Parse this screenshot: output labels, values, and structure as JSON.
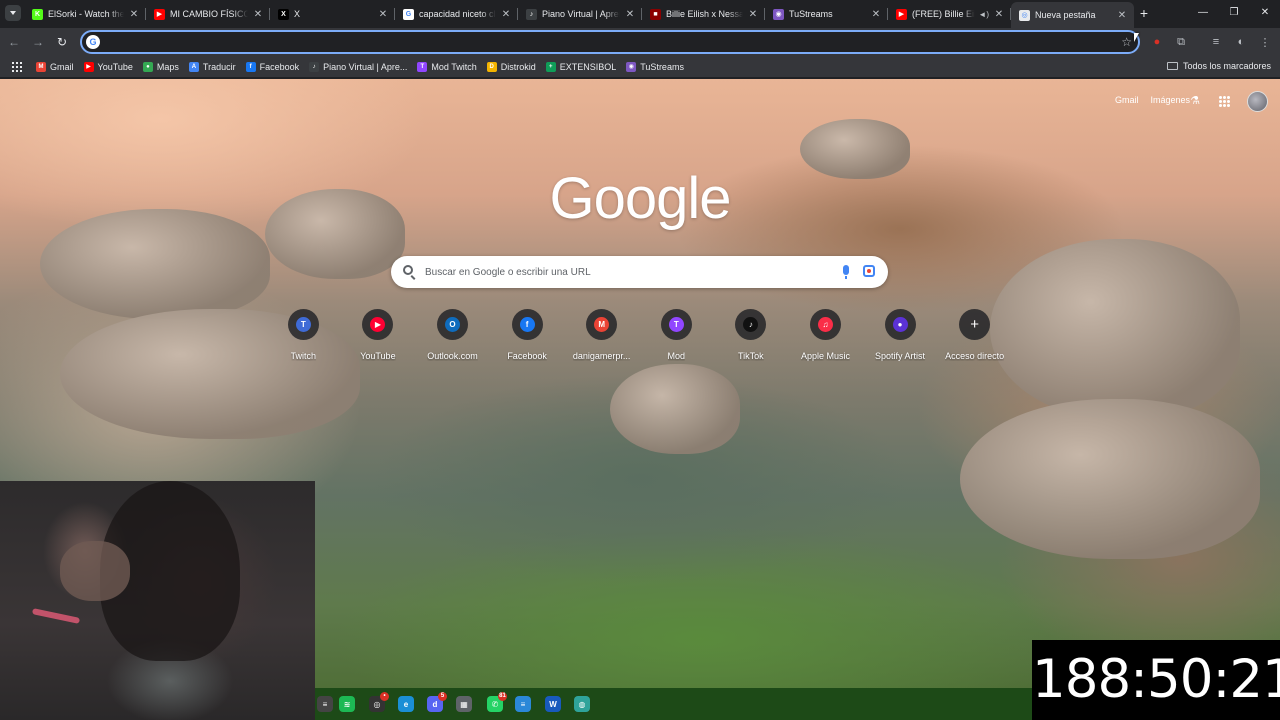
{
  "tabs": [
    {
      "title": "ElSorki - Watch the V",
      "favicon": "kick-icon",
      "color": "#53fc18",
      "glyph": "K",
      "width": 122,
      "active": false
    },
    {
      "title": "MI CAMBIO FÍSICO P",
      "favicon": "youtube-icon",
      "color": "#ff0000",
      "glyph": "▶",
      "width": 124,
      "active": false
    },
    {
      "title": "X",
      "favicon": "x-icon",
      "color": "#000000",
      "glyph": "X",
      "width": 125,
      "active": false
    },
    {
      "title": "capacidad niceto club",
      "favicon": "google-icon",
      "color": "#ffffff",
      "glyph": "G",
      "width": 123,
      "active": false
    },
    {
      "title": "Piano Virtual | Apren",
      "favicon": "piano-icon",
      "color": "#3c4043",
      "glyph": "♪",
      "width": 124,
      "active": false
    },
    {
      "title": "Billie Eilish x Nessa B",
      "favicon": "film-icon",
      "color": "#8b0000",
      "glyph": "■",
      "width": 123,
      "active": false
    },
    {
      "title": "TuStreams",
      "favicon": "tustreams-icon",
      "color": "#7e57c2",
      "glyph": "◉",
      "width": 123,
      "active": false
    },
    {
      "title": "(FREE) Billie Eilish",
      "favicon": "youtube-icon",
      "color": "#ff0000",
      "glyph": "▶",
      "width": 123,
      "active": false,
      "audio": true
    },
    {
      "title": "Nueva pestaña",
      "favicon": "chrome-icon",
      "color": "#e8eaed",
      "glyph": "◎",
      "width": 123,
      "active": true
    }
  ],
  "omnibox": {
    "value": "",
    "placeholder": ""
  },
  "bookmarks": [
    {
      "label": "Gmail",
      "icon": "gmail-icon",
      "color": "#ea4335",
      "glyph": "M"
    },
    {
      "label": "YouTube",
      "icon": "youtube-icon",
      "color": "#ff0000",
      "glyph": "▶"
    },
    {
      "label": "Maps",
      "icon": "maps-icon",
      "color": "#34a853",
      "glyph": "●"
    },
    {
      "label": "Traducir",
      "icon": "translate-icon",
      "color": "#4285f4",
      "glyph": "A"
    },
    {
      "label": "Facebook",
      "icon": "facebook-icon",
      "color": "#1877f2",
      "glyph": "f"
    },
    {
      "label": "Piano Virtual | Apre...",
      "icon": "piano-icon",
      "color": "#3c4043",
      "glyph": "♪"
    },
    {
      "label": "Mod Twitch",
      "icon": "twitch-icon",
      "color": "#9146ff",
      "glyph": "T"
    },
    {
      "label": "Distrokid",
      "icon": "distrokid-icon",
      "color": "#f4b400",
      "glyph": "D"
    },
    {
      "label": "EXTENSIBOL",
      "icon": "sheets-icon",
      "color": "#0f9d58",
      "glyph": "+"
    },
    {
      "label": "TuStreams",
      "icon": "tustreams-icon",
      "color": "#7e57c2",
      "glyph": "◉"
    }
  ],
  "all_bookmarks_label": "Todos los marcadores",
  "ntp": {
    "links": [
      "Gmail",
      "Imágenes"
    ],
    "logo": "Google",
    "search_placeholder": "Buscar en Google o escribir una URL",
    "shortcuts": [
      {
        "label": "Twitch",
        "icon": "twitch-icon",
        "color": "#3f6bd6",
        "glyph": "T"
      },
      {
        "label": "YouTube",
        "icon": "youtube-icon",
        "color": "#ff0033",
        "glyph": "▶"
      },
      {
        "label": "Outlook.com",
        "icon": "outlook-icon",
        "color": "#0f6cbd",
        "glyph": "O"
      },
      {
        "label": "Facebook",
        "icon": "facebook-icon",
        "color": "#1877f2",
        "glyph": "f"
      },
      {
        "label": "danigamerpr...",
        "icon": "gmail-icon",
        "color": "#ea4335",
        "glyph": "M"
      },
      {
        "label": "Mod",
        "icon": "twitch-icon",
        "color": "#9146ff",
        "glyph": "T"
      },
      {
        "label": "TikTok",
        "icon": "tiktok-icon",
        "color": "#111111",
        "glyph": "♪"
      },
      {
        "label": "Apple Music",
        "icon": "apple-music-icon",
        "color": "#fa2d48",
        "glyph": "♫"
      },
      {
        "label": "Spotify Artist",
        "icon": "spotify-icon",
        "color": "#5b32d6",
        "glyph": "●"
      },
      {
        "label": "Acceso directo",
        "icon": "plus-icon",
        "color": "transparent",
        "glyph": "+"
      }
    ]
  },
  "taskbar": [
    {
      "icon": "calculator-icon",
      "color": "#444444",
      "glyph": "≡"
    },
    {
      "icon": "spotify-icon",
      "color": "#1db954",
      "glyph": "≋"
    },
    {
      "icon": "obs-icon",
      "color": "#333333",
      "glyph": "◎",
      "badge": "•"
    },
    {
      "icon": "edge-icon",
      "color": "#1b8fd6",
      "glyph": "e"
    },
    {
      "icon": "discord-icon",
      "color": "#5865f2",
      "glyph": "d",
      "badge": "5"
    },
    {
      "icon": "calculator-icon",
      "color": "#5f6368",
      "glyph": "▦"
    },
    {
      "icon": "whatsapp-icon",
      "color": "#25d366",
      "glyph": "✆",
      "badge": "81"
    },
    {
      "icon": "notepad-icon",
      "color": "#2b88d8",
      "glyph": "≡"
    },
    {
      "icon": "word-icon",
      "color": "#185abd",
      "glyph": "W"
    },
    {
      "icon": "globe-icon",
      "color": "#2fa39a",
      "glyph": "◍"
    }
  ],
  "timer": "188:50:21"
}
